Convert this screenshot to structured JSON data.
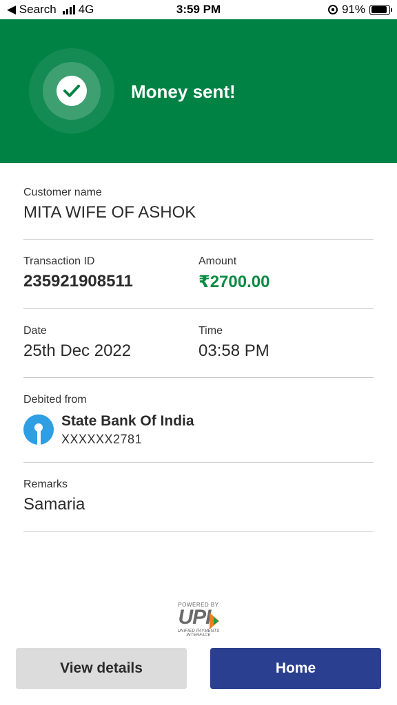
{
  "status_bar": {
    "back_label": "◀ Search",
    "network": "4G",
    "time": "3:59 PM",
    "battery": "91%",
    "battery_level": 0.91
  },
  "hero": {
    "title": "Money sent!",
    "bg_color": "#008244",
    "icon": "check-icon"
  },
  "customer": {
    "label": "Customer name",
    "value": "MITA WIFE OF ASHOK"
  },
  "transaction": {
    "id_label": "Transaction ID",
    "id_value": "235921908511",
    "amount_label": "Amount",
    "amount_value": "₹2700.00",
    "amount_color": "#0a8a43"
  },
  "datetime": {
    "date_label": "Date",
    "date_value": "25th Dec 2022",
    "time_label": "Time",
    "time_value": "03:58 PM"
  },
  "debited": {
    "label": "Debited from",
    "bank_name": "State Bank Of India",
    "account": "XXXXXX2781",
    "icon": "sbi-logo-icon"
  },
  "remarks": {
    "label": "Remarks",
    "value": "Samaria"
  },
  "footer": {
    "powered_by": "POWERED BY",
    "brand": "UPI",
    "brand_sub": "UNIFIED PAYMENTS INTERFACE"
  },
  "buttons": {
    "view_details": "View details",
    "home": "Home",
    "home_color": "#2a3f8f"
  }
}
